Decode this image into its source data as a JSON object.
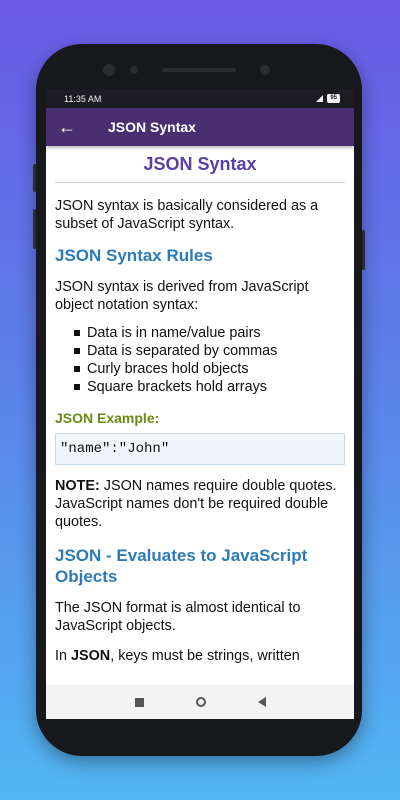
{
  "status": {
    "time": "11:35 AM",
    "battery": "95"
  },
  "appbar": {
    "title": "JSON Syntax",
    "back_icon": "arrow-back-icon"
  },
  "page": {
    "title": "JSON Syntax",
    "intro": "JSON syntax is basically considered as a subset of JavaScript syntax.",
    "rules_heading": "JSON Syntax Rules",
    "rules_intro": "JSON syntax is derived from JavaScript object notation syntax:",
    "rules": [
      "Data is in name/value pairs",
      "Data is separated by commas",
      "Curly braces hold objects",
      "Square brackets hold arrays"
    ],
    "example_heading": "JSON Example:",
    "example_code": "\"name\":\"John\"",
    "note_label": "NOTE:",
    "note_text": " JSON names require double quotes. JavaScript names don't be required double quotes.",
    "eval_heading": "JSON - Evaluates to JavaScript Objects",
    "eval_text": "The JSON format is almost identical to JavaScript objects.",
    "cut_prefix": "In ",
    "cut_bold": "JSON",
    "cut_rest": ", keys must be strings, written"
  },
  "navbar": {
    "icons": [
      "recent-apps-icon",
      "home-icon",
      "back-icon"
    ]
  }
}
